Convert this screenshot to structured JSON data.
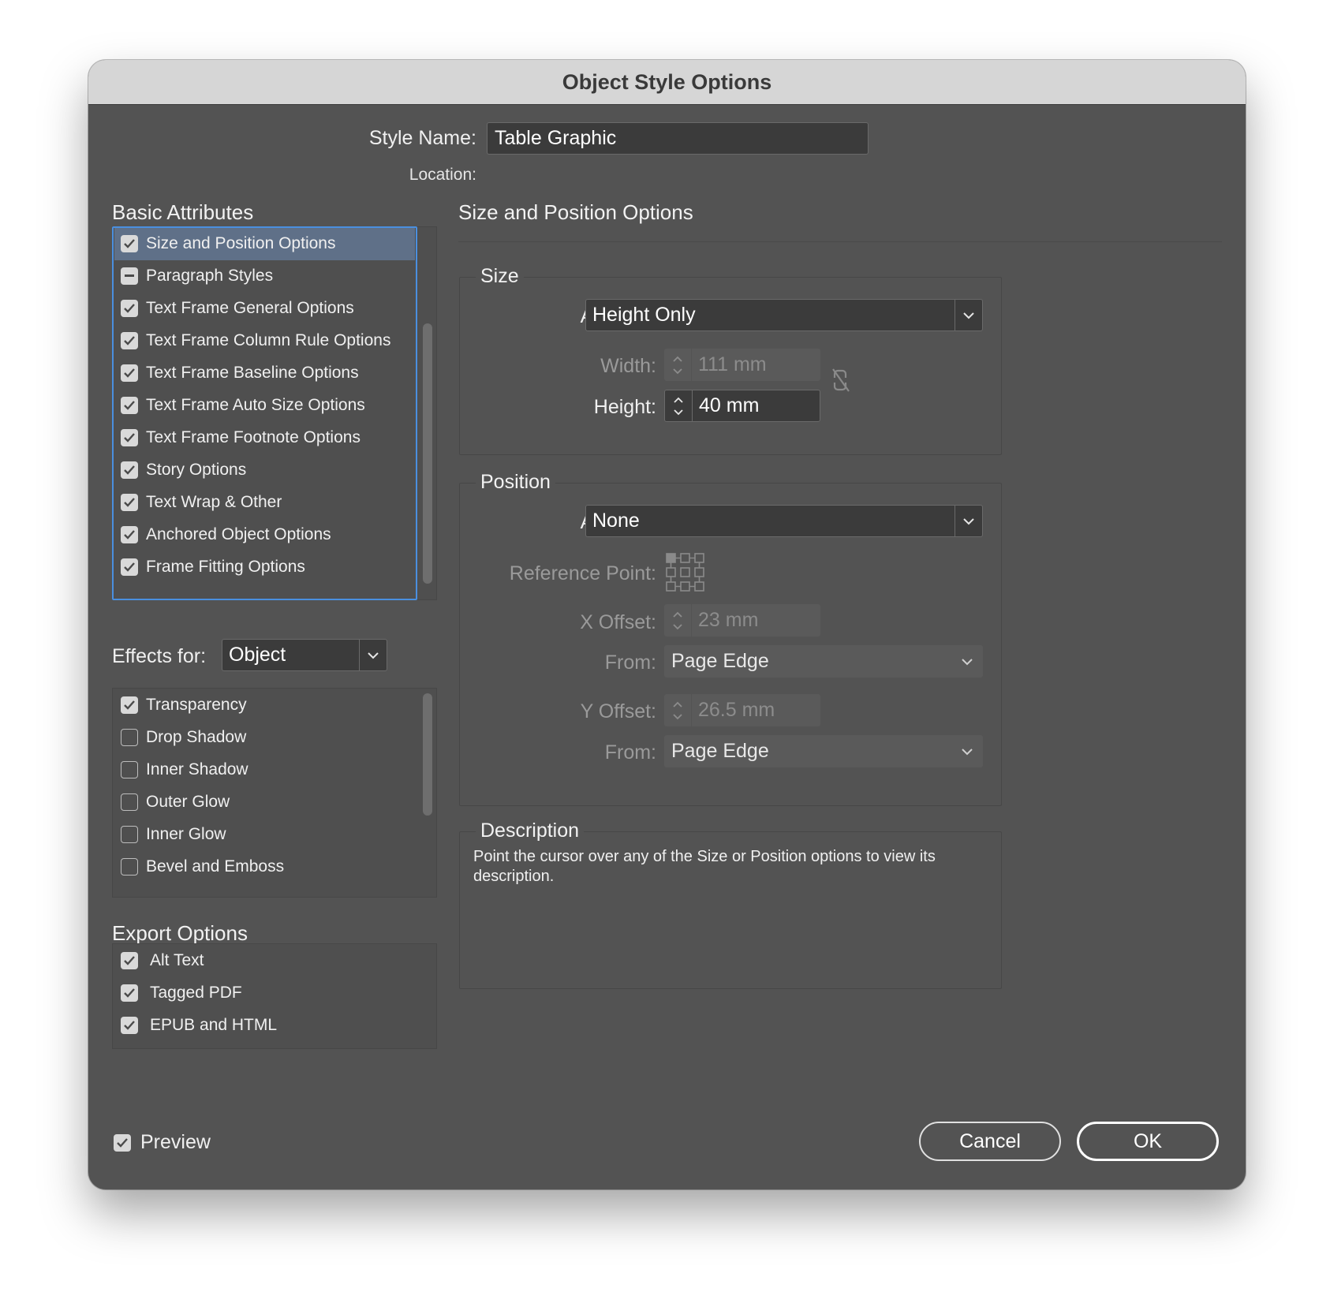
{
  "window": {
    "title": "Object Style Options"
  },
  "header": {
    "style_name_label": "Style Name:",
    "style_name_value": "Table Graphic",
    "location_label": "Location:"
  },
  "basic_attributes": {
    "title": "Basic Attributes",
    "items": [
      {
        "label": "Size and Position Options",
        "state": "checked",
        "selected": true
      },
      {
        "label": "Paragraph Styles",
        "state": "mixed"
      },
      {
        "label": "Text Frame General Options",
        "state": "checked"
      },
      {
        "label": "Text Frame Column Rule Options",
        "state": "checked"
      },
      {
        "label": "Text Frame Baseline Options",
        "state": "checked"
      },
      {
        "label": "Text Frame Auto Size Options",
        "state": "checked"
      },
      {
        "label": "Text Frame Footnote Options",
        "state": "checked"
      },
      {
        "label": "Story Options",
        "state": "checked"
      },
      {
        "label": "Text Wrap & Other",
        "state": "checked"
      },
      {
        "label": "Anchored Object Options",
        "state": "checked"
      },
      {
        "label": "Frame Fitting Options",
        "state": "checked"
      }
    ]
  },
  "effects": {
    "label": "Effects for:",
    "target": "Object",
    "items": [
      {
        "label": "Transparency",
        "state": "checked"
      },
      {
        "label": "Drop Shadow",
        "state": "unchecked"
      },
      {
        "label": "Inner Shadow",
        "state": "unchecked"
      },
      {
        "label": "Outer Glow",
        "state": "unchecked"
      },
      {
        "label": "Inner Glow",
        "state": "unchecked"
      },
      {
        "label": "Bevel and Emboss",
        "state": "unchecked"
      }
    ]
  },
  "export_options": {
    "title": "Export Options",
    "items": [
      {
        "label": "Alt Text",
        "state": "checked"
      },
      {
        "label": "Tagged PDF",
        "state": "checked"
      },
      {
        "label": "EPUB and HTML",
        "state": "checked"
      }
    ]
  },
  "panel": {
    "title": "Size and Position Options",
    "size": {
      "legend": "Size",
      "adjust_label": "Adjust:",
      "adjust_value": "Height Only",
      "width_label": "Width:",
      "width_value": "111 mm",
      "height_label": "Height:",
      "height_value": "40 mm"
    },
    "position": {
      "legend": "Position",
      "adjust_label": "Adjust:",
      "adjust_value": "None",
      "reference_point_label": "Reference Point:",
      "x_offset_label": "X Offset:",
      "x_offset_value": "23 mm",
      "x_from_label": "From:",
      "x_from_value": "Page Edge",
      "y_offset_label": "Y Offset:",
      "y_offset_value": "26.5 mm",
      "y_from_label": "From:",
      "y_from_value": "Page Edge"
    },
    "description": {
      "legend": "Description",
      "text": "Point the cursor over any of the Size or Position options to view its description."
    }
  },
  "footer": {
    "preview_label": "Preview",
    "preview_checked": true,
    "cancel_label": "Cancel",
    "ok_label": "OK"
  },
  "colors": {
    "dialog_bg": "#535353",
    "titlebar_bg": "#d6d6d6",
    "selection": "#5f7088",
    "focus_ring": "#4a8fdf"
  }
}
